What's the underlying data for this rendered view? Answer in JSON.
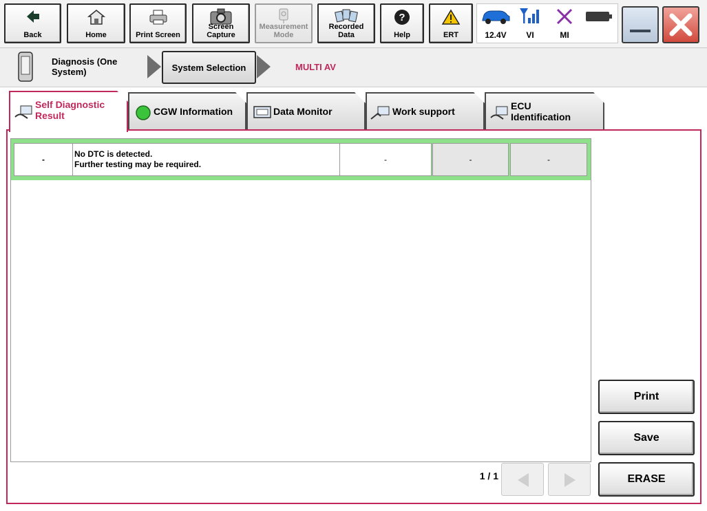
{
  "toolbar": {
    "back": "Back",
    "home": "Home",
    "print_screen": "Print Screen",
    "screen_capture_1": "Screen",
    "screen_capture_2": "Capture",
    "measurement_mode_1": "Measurement",
    "measurement_mode_2": "Mode",
    "recorded_data_1": "Recorded",
    "recorded_data_2": "Data",
    "help": "Help",
    "ert": "ERT"
  },
  "status": {
    "voltage": "12.4V",
    "vi": "VI",
    "mi": "MI"
  },
  "breadcrumb": {
    "diagnosis_1": "Diagnosis (One",
    "diagnosis_2": "System)",
    "system_selection": "System Selection",
    "current_system": "MULTI AV"
  },
  "tabs": {
    "self_diag_1": "Self Diagnostic",
    "self_diag_2": "Result",
    "cgw": "CGW Information",
    "data_monitor": "Data Monitor",
    "work_support": "Work support",
    "ecu_1": "ECU",
    "ecu_2": "Identification"
  },
  "dtc": {
    "code": "-",
    "message_1": "No DTC is detected.",
    "message_2": "Further testing may be required.",
    "col3": "-",
    "col4": "-",
    "col5": "-"
  },
  "actions": {
    "print": "Print",
    "save": "Save",
    "erase": "ERASE"
  },
  "pagination": {
    "page": "1 / 1"
  },
  "colors": {
    "accent": "#c0285b",
    "dtc_row": "#8fe08a"
  }
}
